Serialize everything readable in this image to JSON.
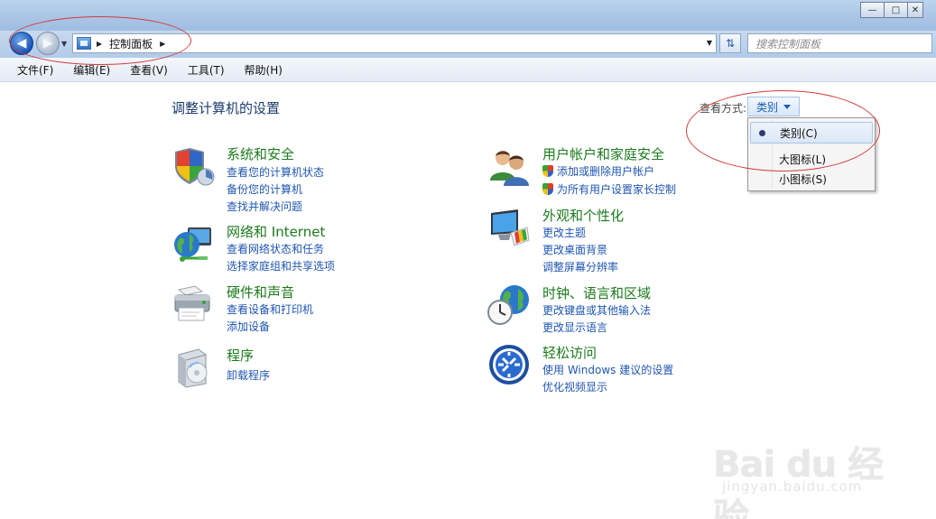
{
  "window": {
    "minimize_glyph": "—",
    "maximize_glyph": "□",
    "close_glyph": "✕"
  },
  "address_bar": {
    "crumbs": [
      "控制面板"
    ],
    "search_placeholder": "搜索控制面板"
  },
  "menu": [
    "文件(F)",
    "编辑(E)",
    "查看(V)",
    "工具(T)",
    "帮助(H)"
  ],
  "content": {
    "title": "调整计算机的设置",
    "view_by_label": "查看方式:",
    "view_by_value": "类别"
  },
  "view_menu": {
    "options": [
      "类别(C)",
      "大图标(L)",
      "小图标(S)"
    ],
    "selected_index": 0
  },
  "categories": [
    {
      "title": "系统和安全",
      "icon": "shield-icon",
      "links": [
        "查看您的计算机状态",
        "备份您的计算机",
        "查找并解决问题"
      ]
    },
    {
      "title": "网络和 Internet",
      "icon": "network-globe-icon",
      "links": [
        "查看网络状态和任务",
        "选择家庭组和共享选项"
      ]
    },
    {
      "title": "硬件和声音",
      "icon": "printer-icon",
      "links": [
        "查看设备和打印机",
        "添加设备"
      ]
    },
    {
      "title": "程序",
      "icon": "programs-disc-icon",
      "links": [
        "卸载程序"
      ]
    },
    {
      "title": "用户帐户和家庭安全",
      "icon": "users-icon",
      "links": [
        "添加或删除用户帐户",
        "为所有用户设置家长控制"
      ]
    },
    {
      "title": "外观和个性化",
      "icon": "monitor-palette-icon",
      "links": [
        "更改主题",
        "更改桌面背景",
        "调整屏幕分辨率"
      ]
    },
    {
      "title": "时钟、语言和区域",
      "icon": "clock-globe-icon",
      "links": [
        "更改键盘或其他输入法",
        "更改显示语言"
      ]
    },
    {
      "title": "轻松访问",
      "icon": "ease-of-access-icon",
      "links": [
        "使用 Windows 建议的设置",
        "优化视频显示"
      ]
    }
  ],
  "watermark": {
    "logo": "Bai du 经验",
    "url": "jingyan.baidu.com"
  },
  "colors": {
    "category_title": "#1c7a1c",
    "link": "#1f56b2",
    "annotation": "#d23b3b"
  }
}
